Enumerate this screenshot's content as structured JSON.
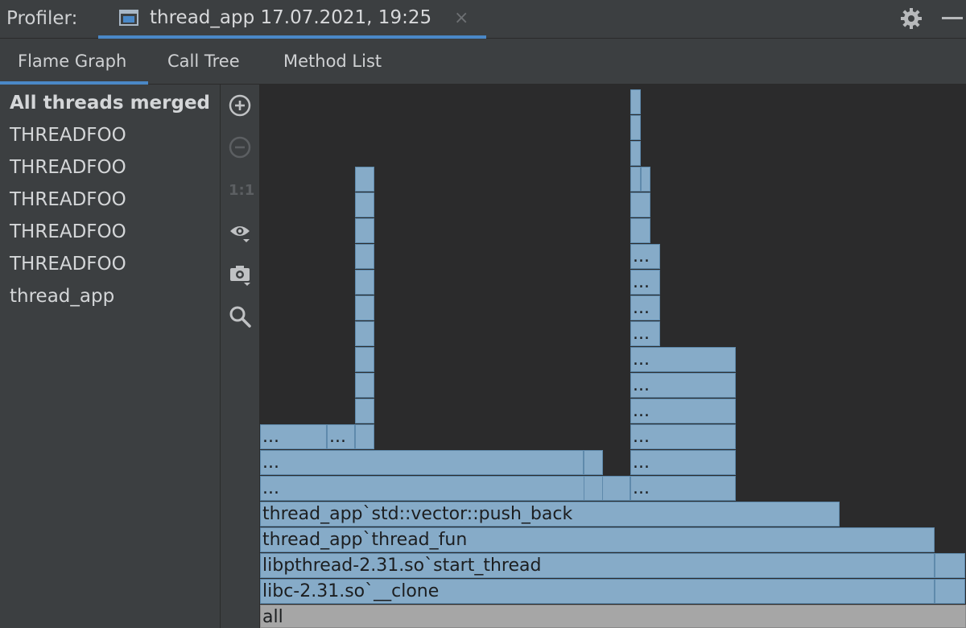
{
  "header": {
    "profiler_label": "Profiler:",
    "session_title": "thread_app 17.07.2021, 19:25",
    "close_glyph": "×",
    "settings_icon": "gear-icon",
    "minimize_icon": "minimize-icon"
  },
  "tabs": [
    {
      "label": "Flame Graph",
      "active": true
    },
    {
      "label": "Call Tree",
      "active": false
    },
    {
      "label": "Method List",
      "active": false
    }
  ],
  "threads": [
    {
      "label": "All threads merged",
      "selected": true
    },
    {
      "label": "THREADFOO"
    },
    {
      "label": "THREADFOO"
    },
    {
      "label": "THREADFOO"
    },
    {
      "label": "THREADFOO"
    },
    {
      "label": "THREADFOO"
    },
    {
      "label": "thread_app"
    }
  ],
  "toolbar": {
    "zoom_in_icon": "zoom-in-icon",
    "zoom_out_icon": "zoom-out-icon",
    "actual_size_label": "1:1",
    "view_options_icon": "eye-icon",
    "capture_icon": "camera-icon",
    "search_icon": "search-icon"
  },
  "flame": {
    "root": "all",
    "clone": "libc-2.31.so`__clone",
    "start_thread": "libpthread-2.31.so`start_thread",
    "thread_fun": "thread_app`thread_fun",
    "push_back": "thread_app`std::vector::push_back",
    "ellipsis": "..."
  },
  "colors": {
    "accent": "#4a88c7",
    "frame_fill": "#86abc8",
    "root_fill": "#a6a6a6",
    "graph_bg": "#2b2b2c"
  }
}
